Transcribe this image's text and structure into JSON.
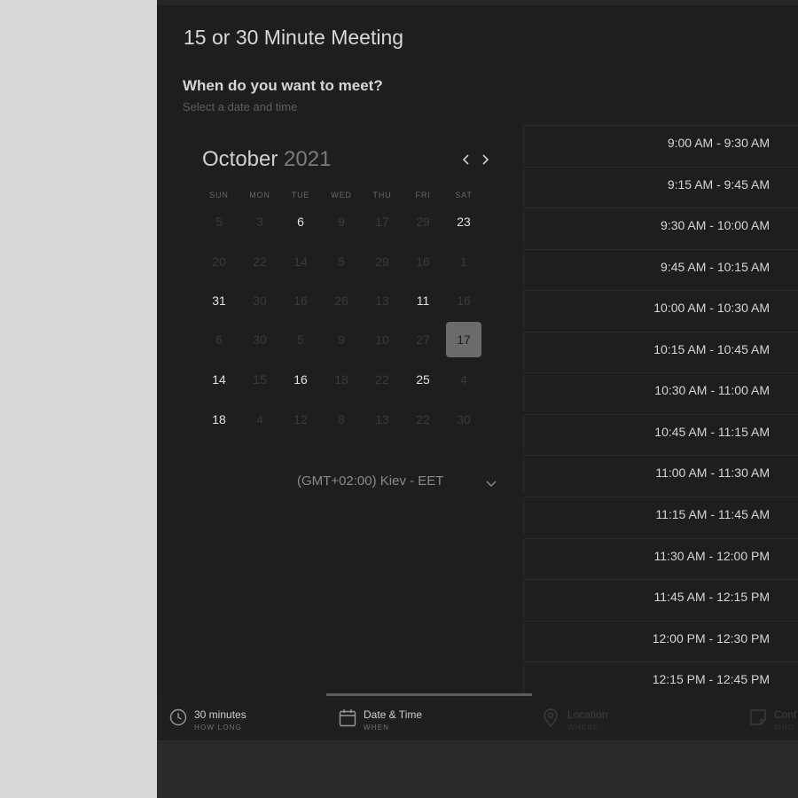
{
  "meeting": {
    "title": "15 or 30 Minute Meeting",
    "question": "When do you want to meet?",
    "subtitle": "Select a date and time"
  },
  "calendar": {
    "month": "October",
    "year": "2021",
    "weekdays": [
      "SUN",
      "MON",
      "TUE",
      "WED",
      "THU",
      "FRI",
      "SAT"
    ],
    "weeks": [
      [
        {
          "d": "5",
          "s": "disabled"
        },
        {
          "d": "3",
          "s": "disabled"
        },
        {
          "d": "6",
          "s": "available"
        },
        {
          "d": "9",
          "s": "disabled"
        },
        {
          "d": "17",
          "s": "disabled"
        },
        {
          "d": "29",
          "s": "disabled"
        },
        {
          "d": "23",
          "s": "available"
        }
      ],
      [
        {
          "d": "20",
          "s": "disabled"
        },
        {
          "d": "22",
          "s": "disabled"
        },
        {
          "d": "14",
          "s": "disabled"
        },
        {
          "d": "5",
          "s": "disabled"
        },
        {
          "d": "29",
          "s": "disabled"
        },
        {
          "d": "16",
          "s": "disabled"
        },
        {
          "d": "1",
          "s": "disabled"
        }
      ],
      [
        {
          "d": "31",
          "s": "available"
        },
        {
          "d": "30",
          "s": "disabled"
        },
        {
          "d": "16",
          "s": "disabled"
        },
        {
          "d": "26",
          "s": "disabled"
        },
        {
          "d": "13",
          "s": "disabled"
        },
        {
          "d": "11",
          "s": "available"
        },
        {
          "d": "16",
          "s": "disabled"
        }
      ],
      [
        {
          "d": "6",
          "s": "disabled"
        },
        {
          "d": "30",
          "s": "disabled"
        },
        {
          "d": "5",
          "s": "disabled"
        },
        {
          "d": "9",
          "s": "disabled"
        },
        {
          "d": "10",
          "s": "disabled"
        },
        {
          "d": "27",
          "s": "disabled"
        },
        {
          "d": "17",
          "s": "selected"
        }
      ],
      [
        {
          "d": "14",
          "s": "available"
        },
        {
          "d": "15",
          "s": "disabled"
        },
        {
          "d": "16",
          "s": "available"
        },
        {
          "d": "18",
          "s": "disabled"
        },
        {
          "d": "22",
          "s": "disabled"
        },
        {
          "d": "25",
          "s": "available"
        },
        {
          "d": "4",
          "s": "disabled"
        }
      ],
      [
        {
          "d": "18",
          "s": "available"
        },
        {
          "d": "4",
          "s": "disabled"
        },
        {
          "d": "12",
          "s": "disabled"
        },
        {
          "d": "8",
          "s": "disabled"
        },
        {
          "d": "13",
          "s": "disabled"
        },
        {
          "d": "22",
          "s": "disabled"
        },
        {
          "d": "30",
          "s": "disabled"
        }
      ]
    ]
  },
  "timezone": {
    "label": "(GMT+02:00) Kiev - EET"
  },
  "slots": [
    "9:00 AM - 9:30 AM",
    "9:15 AM - 9:45 AM",
    "9:30 AM - 10:00 AM",
    "9:45 AM - 10:15 AM",
    "10:00 AM - 10:30 AM",
    "10:15 AM - 10:45 AM",
    "10:30 AM - 11:00 AM",
    "10:45 AM - 11:15 AM",
    "11:00 AM - 11:30 AM",
    "11:15 AM - 11:45 AM",
    "11:30 AM - 12:00 PM",
    "11:45 AM - 12:15 PM",
    "12:00 PM - 12:30 PM",
    "12:15 PM - 12:45 PM"
  ],
  "steps": [
    {
      "label": "30 minutes",
      "sub": "HOW LONG",
      "icon": "clock-icon",
      "state": "active"
    },
    {
      "label": "Date & Time",
      "sub": "WHEN",
      "icon": "calendar-icon",
      "state": "active"
    },
    {
      "label": "Location",
      "sub": "WHERE",
      "icon": "location-pin-icon",
      "state": "inactive"
    },
    {
      "label": "Conf",
      "sub": "WHO",
      "icon": "note-icon",
      "state": "inactive"
    }
  ],
  "colors": {
    "panel_bg": "#1e1e1e",
    "selected_day_bg": "#6b6b6b",
    "outside_bg": "#d9d9d9"
  }
}
